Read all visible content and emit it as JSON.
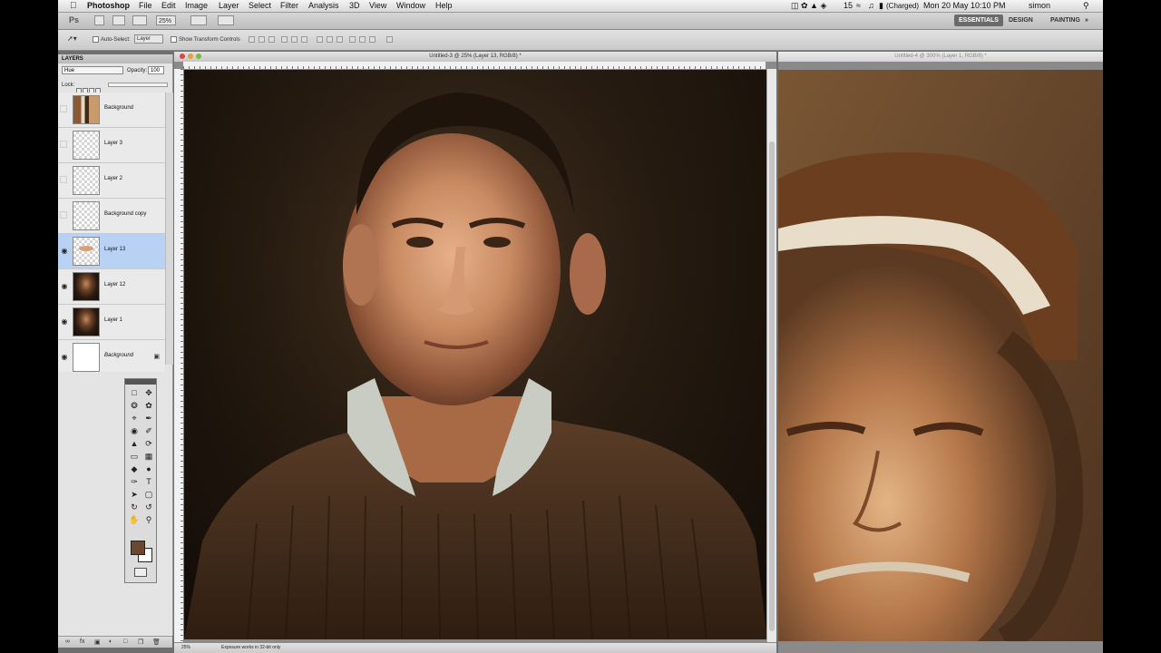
{
  "menubar": {
    "app": "Photoshop",
    "items": [
      "File",
      "Edit",
      "Image",
      "Layer",
      "Select",
      "Filter",
      "Analysis",
      "3D",
      "View",
      "Window",
      "Help"
    ],
    "battery": "(Charged)",
    "clock": "Mon 20 May  10:10 PM",
    "user": "simon",
    "volume_num": "15"
  },
  "appbar": {
    "zoom": "25%",
    "workspaces": [
      "ESSENTIALS",
      "DESIGN",
      "PAINTING"
    ],
    "more": "»"
  },
  "options": {
    "auto_select": "Auto-Select:",
    "auto_select_value": "Layer",
    "show_transform": "Show Transform Controls"
  },
  "layers_panel": {
    "title": "LAYERS",
    "blend_mode": "Hue",
    "opacity_label": "Opacity:",
    "opacity_value": "100",
    "lock_label": "Lock:",
    "layers": [
      {
        "name": "Background",
        "visible": false,
        "thumb": "bgcopy",
        "italic": false,
        "locked": false
      },
      {
        "name": "Layer 3",
        "visible": false,
        "thumb": "trans",
        "italic": false,
        "locked": false
      },
      {
        "name": "Layer 2",
        "visible": false,
        "thumb": "trans",
        "italic": false,
        "locked": false
      },
      {
        "name": "Background copy",
        "visible": false,
        "thumb": "trans",
        "italic": false,
        "locked": false
      },
      {
        "name": "Layer 13",
        "visible": true,
        "thumb": "stroke",
        "italic": false,
        "locked": false
      },
      {
        "name": "Layer 12",
        "visible": true,
        "thumb": "portrait",
        "italic": false,
        "locked": false
      },
      {
        "name": "Layer 1",
        "visible": true,
        "thumb": "portrait",
        "italic": false,
        "locked": false
      },
      {
        "name": "Background",
        "visible": true,
        "thumb": "white",
        "italic": true,
        "locked": true
      }
    ],
    "selected_index": 4
  },
  "doc1": {
    "title": "Untitled-3 @ 25% (Layer 13, RGB/8) *",
    "zoom": "25%",
    "status_msg": "Exposure works in 32-bit only"
  },
  "doc2": {
    "title": "Untitled-4 @ 300% (Layer 1, RGB/8) *"
  },
  "colors": {
    "foreground": "#6a4730",
    "background": "#ffffff",
    "selected_layer": "#b9d2f4"
  }
}
